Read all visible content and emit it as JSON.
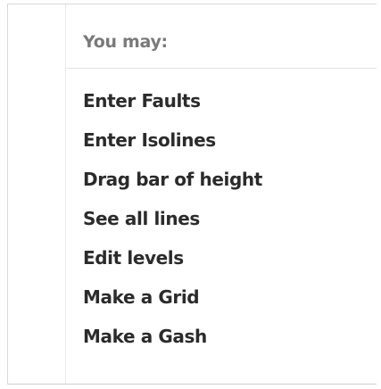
{
  "menu": {
    "header": "You may:",
    "items": [
      {
        "label": "Enter Faults"
      },
      {
        "label": "Enter Isolines"
      },
      {
        "label": "Drag bar of height"
      },
      {
        "label": "See all lines"
      },
      {
        "label": "Edit levels"
      },
      {
        "label": "Make a Grid"
      },
      {
        "label": "Make a Gash"
      }
    ]
  }
}
